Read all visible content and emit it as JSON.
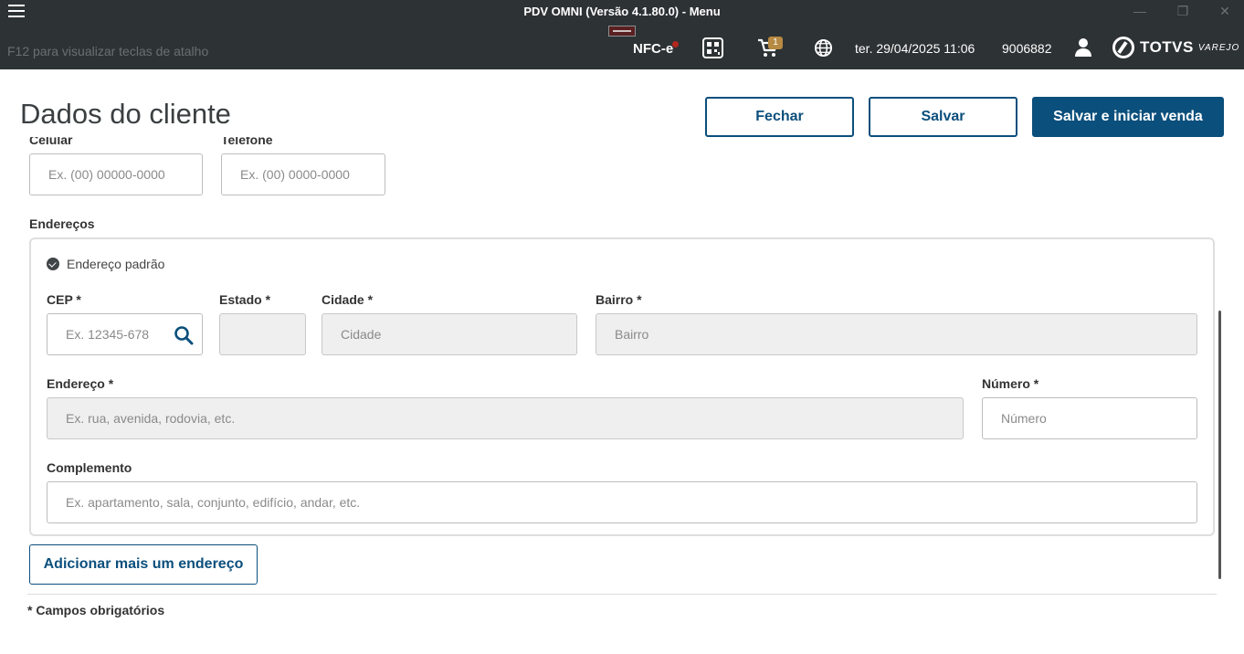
{
  "window": {
    "title": "PDV OMNI (Versão 4.1.80.0) - Menu",
    "minimize_glyph": "—",
    "restore_glyph": "❐",
    "close_glyph": "✕"
  },
  "header": {
    "hint": "F12 para visualizar teclas de atalho",
    "nfce_label": "NFC-e",
    "cart_count": "1",
    "datetime": "ter. 29/04/2025 11:06",
    "user_code": "9006882",
    "logo_name": "TOTVS",
    "logo_sub": "VAREJO",
    "icons": [
      "menu-icon",
      "qr-code-icon",
      "cart-icon",
      "globe-icon",
      "user-icon"
    ]
  },
  "page": {
    "title": "Dados do cliente",
    "actions": {
      "close": "Fechar",
      "save": "Salvar",
      "save_start": "Salvar e iniciar venda"
    }
  },
  "phones": {
    "cell_label": "Celular",
    "cell_placeholder": "Ex. (00) 00000-0000",
    "phone_label": "Telefone",
    "phone_placeholder": "Ex. (00) 0000-0000"
  },
  "addresses": {
    "section_label": "Endereços",
    "default_label": "Endereço padrão",
    "cep_label": "CEP *",
    "cep_placeholder": "Ex. 12345-678",
    "state_label": "Estado *",
    "city_label": "Cidade *",
    "city_placeholder": "Cidade",
    "district_label": "Bairro *",
    "district_placeholder": "Bairro",
    "street_label": "Endereço *",
    "street_placeholder": "Ex. rua, avenida, rodovia, etc.",
    "number_label": "Número *",
    "number_placeholder": "Número",
    "complement_label": "Complemento",
    "complement_placeholder": "Ex. apartamento, sala, conjunto, edifício, andar, etc.",
    "add_button": "Adicionar mais um endereço"
  },
  "footer": {
    "required_note": "* Campos obrigatórios"
  },
  "colors": {
    "topbar": "#2d3234",
    "accent": "#0b4f7c",
    "badge": "#b78a43"
  }
}
